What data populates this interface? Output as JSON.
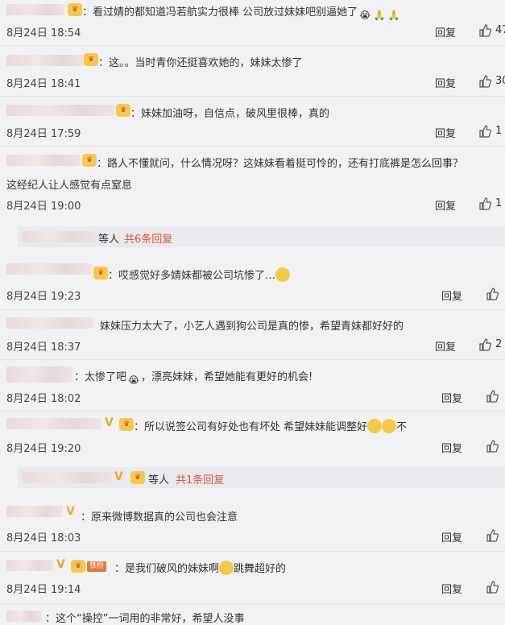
{
  "comments": [
    {
      "text": "：看过婧的都知道冯若航实力很棒  公司放过妹妹吧别逼她了",
      "time": "8月24日 18:54",
      "reply": "回复",
      "likes": "47"
    },
    {
      "text": "：这。。当时青你还挺喜欢她的，妹妹太惨了",
      "time": "8月24日 18:41",
      "reply": "回复",
      "likes": "30"
    },
    {
      "text": "：妹妹加油呀，自信点，破风里很棒，真的",
      "time": "8月24日 17:59",
      "reply": "回复",
      "likes": "1"
    },
    {
      "text": "：路人不懂就问，什么情况呀？这妹妹看着挺可怜的，还有打底裤是怎么回事？",
      "text2": "这经纪人让人感觉有点窒息",
      "time": "8月24日 19:00",
      "reply": "回复",
      "likes": "1"
    },
    {
      "text": "：哎感觉好多婧妹都被公司坑惨了…",
      "time": "8月24日 19:23",
      "reply": "回复"
    },
    {
      "text": "妹妹压力太大了，小艺人遇到狗公司是真的惨，希望青妹都好好的",
      "time": "8月24日 18:37",
      "reply": "回复",
      "likes": "2"
    },
    {
      "text": "：太惨了吧",
      "text2": "，漂亮妹妹，希望她能有更好的机会!",
      "time": "8月24日 18:02",
      "reply": "回复"
    },
    {
      "text": "：所以说签公司有好处也有坏处 希望妹妹能调整好",
      "text2": "不",
      "time": "8月24日 19:20",
      "reply": "回复"
    },
    {
      "text": "：原来微博数据真的公司也会注意",
      "time": "8月24日 18:03",
      "reply": "回复"
    },
    {
      "text": "：是我们破风的妹妹啊",
      "text2": "跳舞超好的",
      "time": "8月24日 19:14",
      "reply": "回复"
    },
    {
      "text": "：这个“操控”一词用的非常好，希望人没事"
    }
  ],
  "threads": [
    {
      "who": "等人",
      "count": "共6条回复"
    },
    {
      "who": "等人",
      "count": "共1条回复"
    }
  ],
  "badges": {
    "vip": "V",
    "fan": "铁粉"
  },
  "emojis": {
    "cry": "😭",
    "pray": "🙏",
    "sweat": "😶",
    "hug": "🫂",
    "shy": "🥺"
  },
  "colors": {
    "accent": "#e0533a",
    "bg": "#f2f2f5",
    "vip": "#f0a71a"
  }
}
